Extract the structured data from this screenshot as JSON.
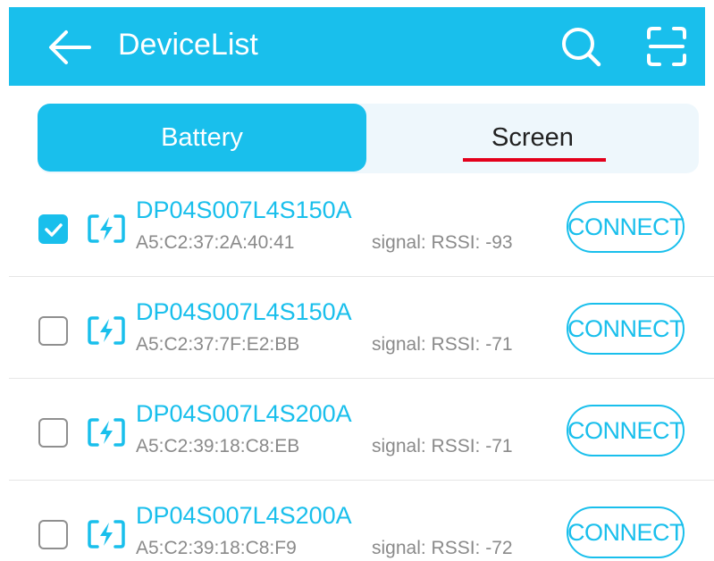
{
  "header": {
    "title": "DeviceList",
    "back_icon": "arrow-left-icon",
    "search_icon": "search-icon",
    "scan_icon": "scan-icon"
  },
  "tabs": [
    {
      "label": "Battery",
      "active": true
    },
    {
      "label": "Screen",
      "active": false
    }
  ],
  "devices": [
    {
      "name": "DP04S007L4S150A",
      "mac": "A5:C2:37:2A:40:41",
      "signal": "signal:  RSSI: -93",
      "checked": true,
      "connect_label": "CONNECT"
    },
    {
      "name": "DP04S007L4S150A",
      "mac": "A5:C2:37:7F:E2:BB",
      "signal": "signal:  RSSI: -71",
      "checked": false,
      "connect_label": "CONNECT"
    },
    {
      "name": "DP04S007L4S200A",
      "mac": "A5:C2:39:18:C8:EB",
      "signal": "signal:  RSSI: -71",
      "checked": false,
      "connect_label": "CONNECT"
    },
    {
      "name": "DP04S007L4S200A",
      "mac": "A5:C2:39:18:C8:F9",
      "signal": "signal:  RSSI: -72",
      "checked": false,
      "connect_label": "CONNECT"
    }
  ],
  "colors": {
    "accent": "#19bfec",
    "tab_underline": "#e3001b",
    "secondary_text": "#8a8a8a"
  }
}
